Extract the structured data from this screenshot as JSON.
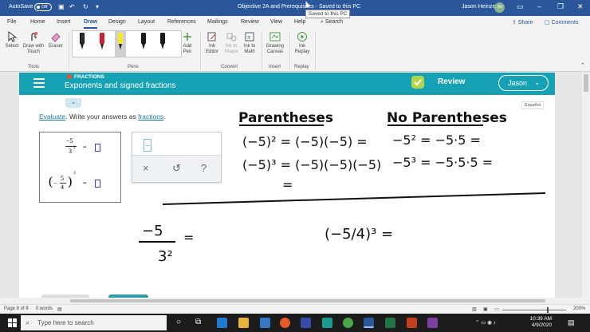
{
  "titlebar": {
    "autosave_label": "AutoSave",
    "autosave_state": "Off",
    "document_title": "Objective 2A and Prerequisites",
    "save_status": "Saved to this PC",
    "user_name": "Jason Heinze",
    "user_initials": "JH",
    "tooltip": "Saved to this PC"
  },
  "tabs": {
    "items": [
      "File",
      "Home",
      "Insert",
      "Draw",
      "Design",
      "Layout",
      "References",
      "Mailings",
      "Review",
      "View",
      "Help"
    ],
    "active": "Draw",
    "tell_me": "Search",
    "share": "Share",
    "comments": "Comments"
  },
  "ribbon": {
    "tools": {
      "select": "Select",
      "draw_touch": "Draw with Touch",
      "eraser": "Eraser",
      "group": "Tools"
    },
    "pens_group": "Pens",
    "add_pen": "Add Pen",
    "convert": {
      "ink_editor": "Ink Editor",
      "ink_to_shape": "Ink to Shape",
      "ink_to_math": "Ink to Math",
      "group": "Convert"
    },
    "insert": {
      "drawing_canvas": "Drawing Canvas",
      "group": "Insert"
    },
    "replay": {
      "ink_replay": "Ink Replay",
      "group": "Replay"
    },
    "pen_colors": [
      "#2d2d2d",
      "#d11f2c",
      "#f3ea2a",
      "#1b1b1b",
      "#1b1b1b",
      "#1b1b1b"
    ]
  },
  "app": {
    "breadcrumb": "FRACTIONS",
    "topic": "Exponents and signed fractions",
    "review": "Review",
    "user": "Jason",
    "espanol": "Español",
    "instruction_pre": "Evaluate",
    "instruction_mid": ". Write your answers as ",
    "instruction_link": "fractions",
    "instruction_post": ".",
    "problems": [
      {
        "num": "−5",
        "den": "3",
        "exp": "2",
        "eq": "="
      },
      {
        "open": "(",
        "sign": "−",
        "num": "5",
        "den": "4",
        "close": ")",
        "exp": "3",
        "eq": "="
      }
    ],
    "palette": {
      "clear": "×",
      "undo": "↺",
      "help": "?"
    },
    "accent": "#16a2b4"
  },
  "ink": {
    "heading_left": "Parentheses",
    "heading_right": "No Parentheses",
    "line1_left": "(−5)² = (−5)(−5) =",
    "line2_left": "(−5)³ = (−5)(−5)(−5)",
    "line3_left": "=",
    "line1_right": "−5² = −5·5 =",
    "line2_right": "−5³ = −5·5·5 =",
    "bottom_left_num": "−5",
    "bottom_left_den": "3²",
    "bottom_left_eq": "=",
    "bottom_right": "(−5/4)³ ="
  },
  "status": {
    "page": "Page 8 of 8",
    "words": "0 words",
    "zoom": "200%"
  },
  "taskbar": {
    "search_placeholder": "Type here to search",
    "time": "10:39 AM",
    "date": "4/9/2020"
  }
}
